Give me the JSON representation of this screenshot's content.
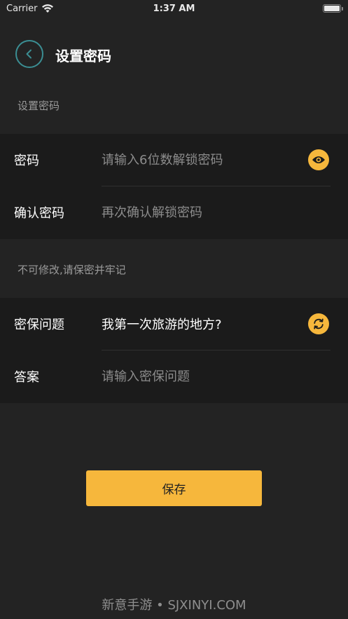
{
  "status_bar": {
    "carrier": "Carrier",
    "time": "1:37 AM"
  },
  "nav": {
    "title": "设置密码",
    "back_icon": "chevron-left-icon"
  },
  "section1": {
    "label": "设置密码",
    "rows": [
      {
        "label": "密码",
        "placeholder": "请输入6位数解锁密码",
        "action_icon": "eye-icon"
      },
      {
        "label": "确认密码",
        "placeholder": "再次确认解锁密码"
      }
    ]
  },
  "section2": {
    "label": "不可修改,请保密并牢记",
    "rows": [
      {
        "label": "密保问题",
        "value": "我第一次旅游的地方?",
        "action_icon": "refresh-icon"
      },
      {
        "label": "答案",
        "placeholder": "请输入密保问题"
      }
    ]
  },
  "save_button": {
    "label": "保存"
  },
  "watermark": "新意手游 • SJXINYI.COM",
  "colors": {
    "accent": "#f6b73c",
    "background": "#232323",
    "row_background": "#1b1b1b",
    "back_ring": "#3b8e93"
  }
}
